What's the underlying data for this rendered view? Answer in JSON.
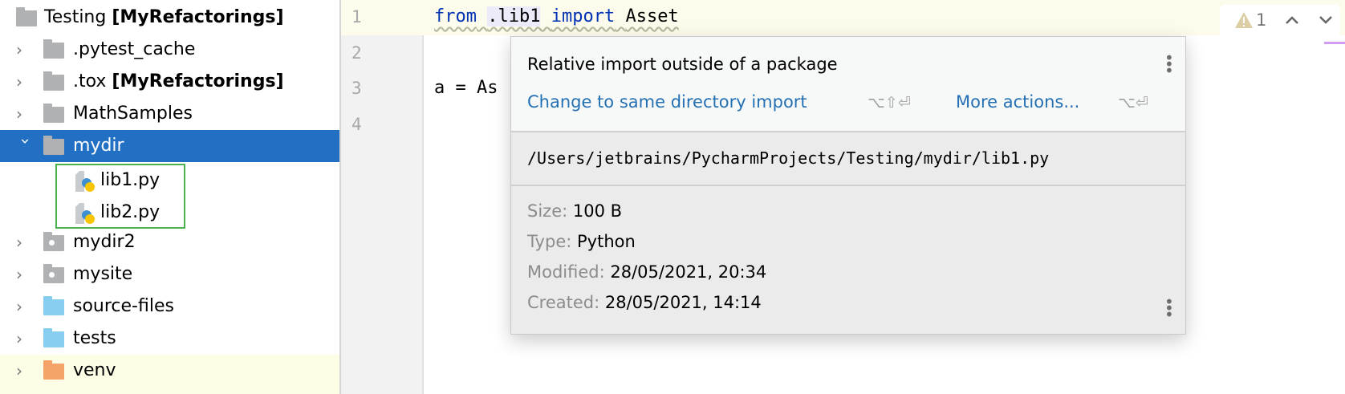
{
  "sidebar": {
    "items": [
      {
        "name": "Testing",
        "suffix": "[MyRefactorings]",
        "kind": "root"
      },
      {
        "name": ".pytest_cache",
        "suffix": "",
        "kind": "folder"
      },
      {
        "name": ".tox",
        "suffix": "[MyRefactorings]",
        "kind": "folder"
      },
      {
        "name": "MathSamples",
        "suffix": "",
        "kind": "folder"
      },
      {
        "name": "mydir",
        "suffix": "",
        "kind": "folder-open",
        "selected": true
      },
      {
        "name": "lib1.py",
        "kind": "file"
      },
      {
        "name": "lib2.py",
        "kind": "file"
      },
      {
        "name": "mydir2",
        "suffix": "",
        "kind": "package"
      },
      {
        "name": "mysite",
        "suffix": "",
        "kind": "package"
      },
      {
        "name": "source-files",
        "suffix": "",
        "kind": "source"
      },
      {
        "name": "tests",
        "suffix": "",
        "kind": "source"
      },
      {
        "name": "venv",
        "suffix": "",
        "kind": "excluded"
      }
    ]
  },
  "editor": {
    "line_numbers": [
      "1",
      "2",
      "3",
      "4"
    ],
    "line1": {
      "kw1": "from",
      "module": ".lib1",
      "kw2": "import",
      "name": "Asset"
    },
    "line3": "a = As",
    "problems": {
      "count": "1",
      "icon": "warning-icon"
    }
  },
  "popup": {
    "title": "Relative import outside of a package",
    "action": "Change to same directory import",
    "action_shortcut": "⌥⇧⏎",
    "more": "More actions...",
    "more_shortcut": "⌥⏎",
    "path": "/Users/jetbrains/PycharmProjects/Testing/mydir/lib1.py",
    "size_label": "Size:",
    "size": "100 B",
    "type_label": "Type:",
    "type": "Python",
    "modified_label": "Modified:",
    "modified": "28/05/2021, 20:34",
    "created_label": "Created:",
    "created": "28/05/2021, 14:14"
  },
  "colors": {
    "selection": "#2270c3",
    "keyword": "#0033b3",
    "link": "#2470b3",
    "highlight_box": "#4caf50"
  }
}
